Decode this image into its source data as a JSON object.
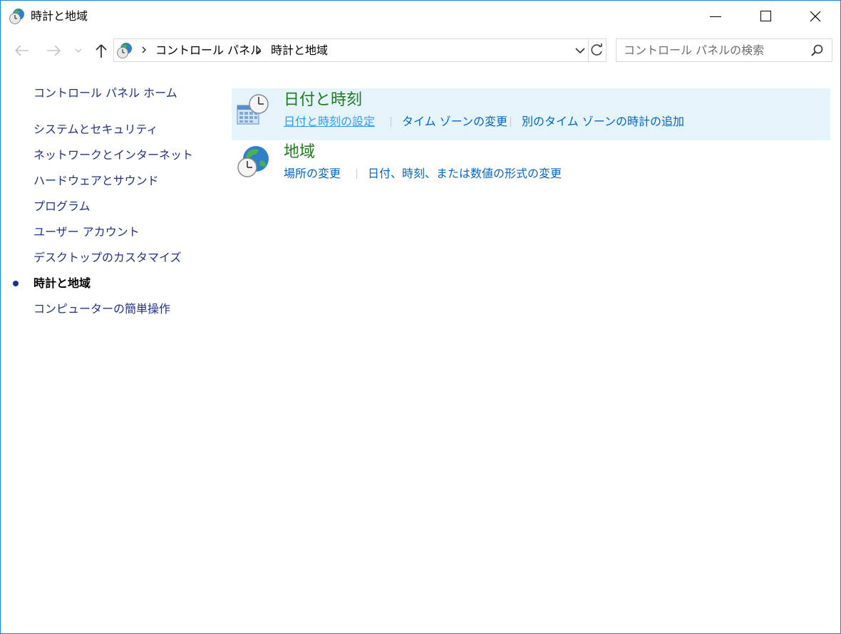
{
  "window": {
    "title": "時計と地域"
  },
  "nav": {
    "breadcrumb": [
      "コントロール パネル",
      "時計と地域"
    ]
  },
  "search": {
    "placeholder": "コントロール パネルの検索"
  },
  "sidebar": {
    "items": [
      {
        "label": "コントロール パネル ホーム",
        "active": false
      },
      {
        "label": "システムとセキュリティ",
        "active": false
      },
      {
        "label": "ネットワークとインターネット",
        "active": false
      },
      {
        "label": "ハードウェアとサウンド",
        "active": false
      },
      {
        "label": "プログラム",
        "active": false
      },
      {
        "label": "ユーザー アカウント",
        "active": false
      },
      {
        "label": "デスクトップのカスタマイズ",
        "active": false
      },
      {
        "label": "時計と地域",
        "active": true
      },
      {
        "label": "コンピューターの簡単操作",
        "active": false
      }
    ]
  },
  "categories": [
    {
      "title": "日付と時刻",
      "icon": "calendar-clock-icon",
      "links": [
        "日付と時刻の設定",
        "タイム ゾーンの変更",
        "別のタイム ゾーンの時計の追加"
      ]
    },
    {
      "title": "地域",
      "icon": "globe-clock-icon",
      "links": [
        "場所の変更",
        "日付、時刻、または数値の形式の変更"
      ]
    }
  ],
  "colors": {
    "accent_border": "#1883d7",
    "category_title": "#1e7b1e",
    "link": "#0066cc",
    "sidebar_link": "#1e3287",
    "highlight_bg": "#e5f3fb"
  }
}
